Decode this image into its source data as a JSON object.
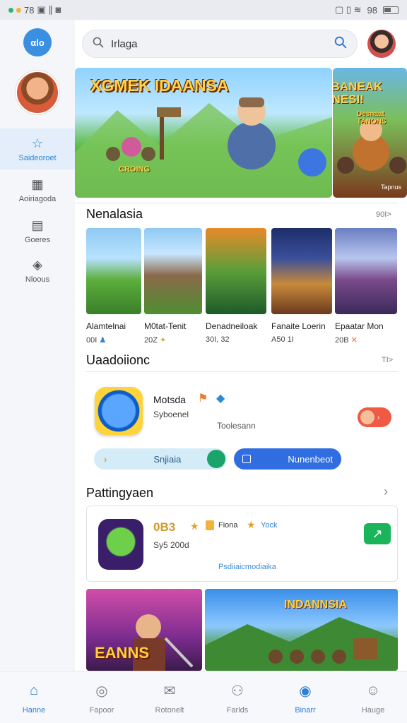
{
  "status_bar": {
    "time": "78",
    "battery_text": "98"
  },
  "app": {
    "logo_text": "αlo"
  },
  "search": {
    "value": "Irlaga"
  },
  "sidebar": {
    "items": [
      {
        "label": "Saideoroet",
        "icon": "star-hat-icon"
      },
      {
        "label": "Aoiriagoda",
        "icon": "grid-icon"
      },
      {
        "label": "Goeres",
        "icon": "document-icon"
      },
      {
        "label": "Nloous",
        "icon": "tag-icon"
      }
    ]
  },
  "hero": {
    "main_title": "XGMEK IDAANSA",
    "main_subtitle": "CROING",
    "second_title": "BEBANEAK NANESI!",
    "second_subtitle": "Desnaat TANONS",
    "second_footer": "Tapnus"
  },
  "section1": {
    "title": "Nenalasia",
    "more": "90I>",
    "games": [
      {
        "name": "Alamtelnai",
        "meta": "00I"
      },
      {
        "name": "M0tat-Tenit",
        "meta": "20Z"
      },
      {
        "name": "Denadneiloak",
        "meta": "30I, 32"
      },
      {
        "name": "Fanaite Loerin",
        "meta": "A50 1I"
      },
      {
        "name": "Epaatar Mon",
        "meta": "20B"
      }
    ]
  },
  "section2": {
    "title": "Uaadoiionc",
    "more": "TI>",
    "feature": {
      "title": "Motsda",
      "subtitle": "Syboenel",
      "extra": "Toolesann",
      "badges": [
        "orange-badge",
        "blue-badge"
      ]
    },
    "buttons": {
      "light": "Snjiaia",
      "primary": "Nunenbeot"
    }
  },
  "section3": {
    "title": "Pattingyaen",
    "card": {
      "rating": "0B3",
      "chip1": "Fiona",
      "chip2": "Yock",
      "subtitle": "Sy5 200d",
      "link": "Psdiiaicmodiaika"
    }
  },
  "bottom_cards": {
    "left_title": "EANNS",
    "right_title": "INDANNSIA"
  },
  "bottom_nav": [
    {
      "label": "Hanne",
      "icon": "home-icon",
      "active": false
    },
    {
      "label": "Fapoor",
      "icon": "compass-icon",
      "active": false
    },
    {
      "label": "Rotonelt",
      "icon": "mail-icon",
      "active": false
    },
    {
      "label": "Farlds",
      "icon": "friends-icon",
      "active": false
    },
    {
      "label": "Binarr",
      "icon": "rank-icon",
      "active": true
    },
    {
      "label": "Hauge",
      "icon": "profile-icon",
      "active": false
    }
  ]
}
